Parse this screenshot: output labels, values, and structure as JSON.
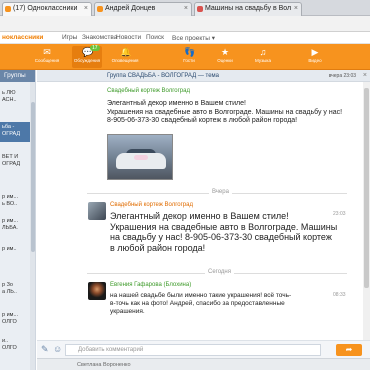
{
  "browser": {
    "tabs": [
      {
        "label": "(17) Одноклассники",
        "color": "#f7931e"
      },
      {
        "label": "Андрей Донцев",
        "color": "#f7931e"
      },
      {
        "label": "Машины на свадьбу в Вол",
        "color": "#d9534f"
      }
    ]
  },
  "topnav": {
    "logo": "ноклассники",
    "items": [
      "Игры",
      "Знакомства",
      "Новости",
      "Поиск",
      "Все проекты ▾"
    ]
  },
  "toolbar": {
    "items": [
      {
        "label": "Сообщения",
        "icon": "envelope-icon",
        "glyph": "✉"
      },
      {
        "label": "Обсуждения",
        "icon": "chat-bubble-icon",
        "glyph": "💬",
        "badge": "17"
      },
      {
        "label": "Оповещения",
        "icon": "bell-icon",
        "glyph": "🔔"
      },
      {
        "label": "Гости",
        "icon": "footprints-icon",
        "glyph": "👣"
      },
      {
        "label": "Оценки",
        "icon": "star-icon",
        "glyph": "★"
      },
      {
        "label": "Музыка",
        "icon": "music-icon",
        "glyph": "♫"
      },
      {
        "label": "Видео",
        "icon": "video-icon",
        "glyph": "▶"
      }
    ]
  },
  "leftpane": {
    "header": "Группы",
    "items": [
      {
        "lines": [
          "ь ЛЮ",
          "АСН.."
        ]
      },
      {
        "lines": [
          "ьба -",
          "ОГРАД"
        ],
        "selected": true
      },
      {
        "lines": [
          "ВЕТ И",
          "ОГРАД"
        ]
      },
      {
        "lines": [
          "р им...",
          "ь ВО.."
        ]
      },
      {
        "lines": [
          "р им...",
          "ЛЬБА."
        ]
      },
      {
        "lines": [
          "р им.."
        ]
      },
      {
        "lines": [
          "р Зо",
          "а ЛЬ.."
        ]
      },
      {
        "lines": [
          "р им...",
          "ОЛГО"
        ]
      },
      {
        "lines": [
          "и..",
          "ОЛГО"
        ]
      }
    ]
  },
  "chat": {
    "header_title": "Группа СВАДЬБА - ВОЛГОГРАД — тема",
    "header_time": "вчера 23:03",
    "messages": [
      {
        "author": "Свадебный кортеж Волгоград",
        "text": "Элегантный декор именно в Вашем стиле!\nУкрашения на свадебные авто в Волгограде. Машины на свадьбу у нас!\n8-905-06-373-30 свадебный кортеж в любой район города!"
      },
      {
        "author": "Свадебный кортеж Волгоград",
        "text": "Элегантный декор именно в Вашем стиле!\nУкрашения на свадебные авто в Волгограде. Машины\nна свадьбу у нас! 8-905-06-373-30 свадебный кортеж\nв любой район города!",
        "time": "23:03"
      },
      {
        "author": "Евгения Гафарова (Блохина)",
        "text": "на нашей свадьбе были именно такие украшения! всё точь-\nв-точь как на фото! Андрей, спасибо за предоставленные\nукрашения.",
        "time": "08:33"
      }
    ],
    "dividers": [
      "Вчера",
      "Сегодня"
    ],
    "comment_placeholder": "Добавить комментарий",
    "send_glyph": "➦"
  },
  "statusbar": {
    "text": "Светлана Вороненко"
  }
}
